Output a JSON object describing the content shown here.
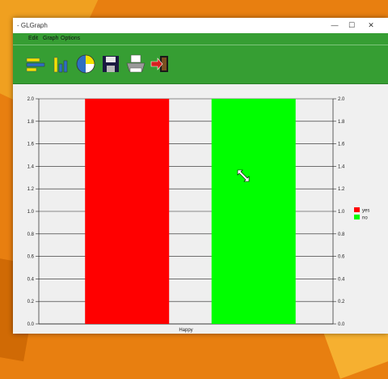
{
  "window": {
    "title": "- GLGraph",
    "controls": {
      "minimize": "—",
      "maximize": "☐",
      "close": "✕"
    }
  },
  "menu": {
    "items": [
      "Edit",
      "Graph",
      "Options"
    ]
  },
  "toolbar": {
    "buttons": [
      "bar-chart-horizontal-icon",
      "bar-chart-vertical-icon",
      "pie-chart-icon",
      "save-icon",
      "print-icon",
      "exit-icon"
    ]
  },
  "colors": {
    "accent": "#369e33",
    "yes": "#ff0000",
    "no": "#00ff00"
  },
  "chart_data": {
    "type": "bar",
    "categories": [
      "Happy"
    ],
    "series": [
      {
        "name": "yes",
        "values": [
          2.0
        ],
        "color": "#ff0000"
      },
      {
        "name": "no",
        "values": [
          2.0
        ],
        "color": "#00ff00"
      }
    ],
    "ylim": [
      0,
      2.0
    ],
    "y_ticks": [
      "0.0",
      "0.2",
      "0.4",
      "0.6",
      "0.8",
      "1.0",
      "1.2",
      "1.4",
      "1.6",
      "1.8",
      "2.0"
    ],
    "grid": true,
    "legend_position": "right"
  }
}
